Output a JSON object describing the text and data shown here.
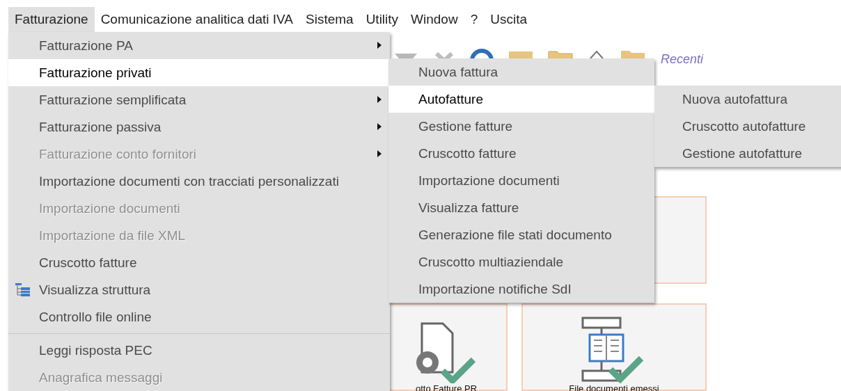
{
  "menubar": [
    {
      "label": "Fatturazione",
      "selected": true
    },
    {
      "label": "Comunicazione analitica dati IVA",
      "selected": false
    },
    {
      "label": "Sistema",
      "selected": false
    },
    {
      "label": "Utility",
      "selected": false
    },
    {
      "label": "Window",
      "selected": false
    },
    {
      "label": "?",
      "selected": false
    },
    {
      "label": "Uscita",
      "selected": false
    }
  ],
  "toolbar": {
    "recent_label": "Recenti"
  },
  "tiles": [
    {
      "label": "otto Fatture PR",
      "kind": "gear-document"
    },
    {
      "label": "File documenti emessi",
      "kind": "flowchart"
    }
  ],
  "menu": {
    "items": [
      {
        "kind": "item",
        "label": "Fatturazione PA",
        "disabled": false,
        "submenu": true,
        "selected": false
      },
      {
        "kind": "item",
        "label": "Fatturazione privati",
        "disabled": false,
        "submenu": false,
        "selected": true
      },
      {
        "kind": "item",
        "label": "Fatturazione semplificata",
        "disabled": false,
        "submenu": true,
        "selected": false
      },
      {
        "kind": "item",
        "label": "Fatturazione passiva",
        "disabled": false,
        "submenu": true,
        "selected": false
      },
      {
        "kind": "item",
        "label": "Fatturazione conto fornitori",
        "disabled": true,
        "submenu": true,
        "selected": false
      },
      {
        "kind": "item",
        "label": "Importazione documenti con tracciati personalizzati",
        "disabled": false,
        "submenu": false,
        "selected": false
      },
      {
        "kind": "item",
        "label": "Importazione documenti",
        "disabled": true,
        "submenu": false,
        "selected": false
      },
      {
        "kind": "item",
        "label": "Importazione da file XML",
        "disabled": true,
        "submenu": false,
        "selected": false
      },
      {
        "kind": "item",
        "label": "Cruscotto fatture",
        "disabled": false,
        "submenu": false,
        "selected": false
      },
      {
        "kind": "tree_item",
        "label": "Visualizza struttura",
        "disabled": false,
        "submenu": false,
        "selected": false
      },
      {
        "kind": "item",
        "label": "Controllo file online",
        "disabled": false,
        "submenu": false,
        "selected": false
      },
      {
        "kind": "separator"
      },
      {
        "kind": "item",
        "label": "Leggi risposta PEC",
        "disabled": false,
        "submenu": false,
        "selected": false
      },
      {
        "kind": "item",
        "label": "Anagrafica messaggi",
        "disabled": true,
        "submenu": false,
        "selected": false
      }
    ]
  },
  "submenu": {
    "items": [
      {
        "label": "Nuova fattura",
        "selected": false
      },
      {
        "label": "Autofatture",
        "selected": true
      },
      {
        "label": "Gestione fatture",
        "selected": false
      },
      {
        "label": "Cruscotto fatture",
        "selected": false
      },
      {
        "label": "Importazione documenti",
        "selected": false
      },
      {
        "label": "Visualizza fatture",
        "selected": false
      },
      {
        "label": "Generazione file stati documento",
        "selected": false
      },
      {
        "label": "Cruscotto multiaziendale",
        "selected": false
      },
      {
        "label": "Importazione notifiche SdI",
        "selected": false
      }
    ]
  },
  "submenu_autofatture": {
    "items": [
      {
        "label": "Nuova autofattura",
        "selected": false
      },
      {
        "label": "Cruscotto autofatture",
        "selected": false
      },
      {
        "label": "Gestione autofatture",
        "selected": false
      }
    ]
  }
}
